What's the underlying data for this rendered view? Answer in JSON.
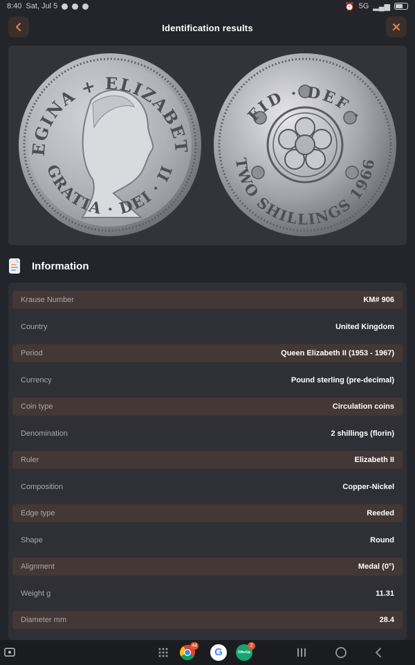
{
  "status_bar": {
    "time": "8:40",
    "date": "Sat, Jul 5",
    "network": "5G"
  },
  "header": {
    "title": "Identification results",
    "back_icon": "chevron-left-icon",
    "close_icon": "close-icon",
    "accent": "#e6834e"
  },
  "coin": {
    "obverse_legend_top": "REGINA + ELIZABETH",
    "obverse_legend_bottom": "GRATIA · DEI · II",
    "reverse_legend_top": "FID · DEF ·",
    "reverse_legend_bottom": "TWO SHILLINGS 1966"
  },
  "section": {
    "title": "Information",
    "icon": "document-icon"
  },
  "info_rows": [
    {
      "label": "Krause Number",
      "value": "KM# 906"
    },
    {
      "label": "Country",
      "value": "United Kingdom"
    },
    {
      "label": "Period",
      "value": "Queen Elizabeth II (1953 - 1967)"
    },
    {
      "label": "Currency",
      "value": "Pound sterling (pre-decimal)"
    },
    {
      "label": "Coin type",
      "value": "Circulation coins"
    },
    {
      "label": "Denomination",
      "value": "2 shillings (florin)"
    },
    {
      "label": "Ruler",
      "value": "Elizabeth II"
    },
    {
      "label": "Composition",
      "value": "Copper-Nickel"
    },
    {
      "label": "Edge type",
      "value": "Reeded"
    },
    {
      "label": "Shape",
      "value": "Round"
    },
    {
      "label": "Alignment",
      "value": "Medal (0°)"
    },
    {
      "label": "Weight g",
      "value": "11.31"
    },
    {
      "label": "Diameter mm",
      "value": "28.4"
    }
  ],
  "nav_bar": {
    "chrome_badge": "44",
    "offerup_badge": "2",
    "offerup_label": "OfferUp",
    "google_letter": "G"
  }
}
